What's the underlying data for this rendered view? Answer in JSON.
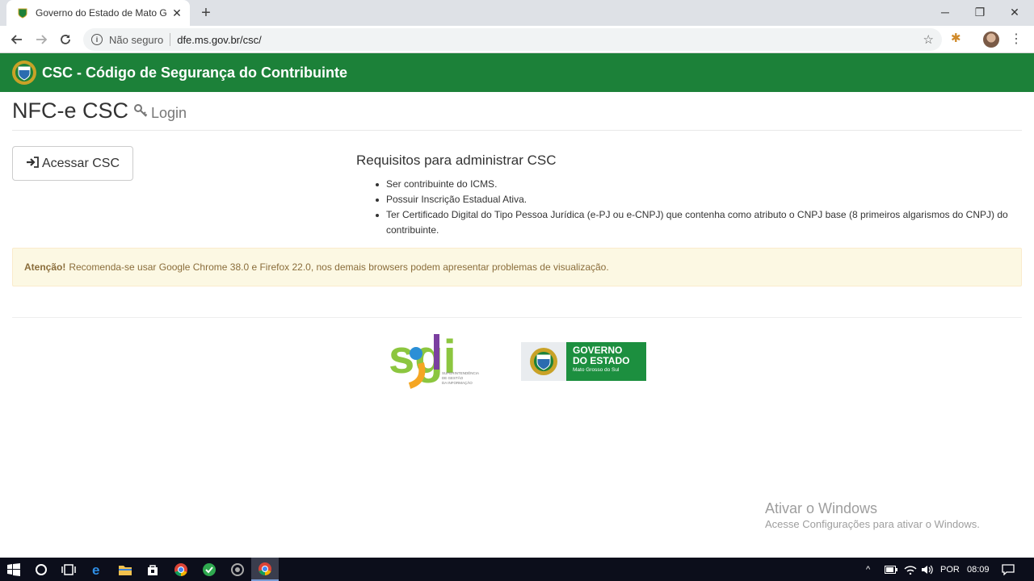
{
  "browser": {
    "tab_title": "Governo do Estado de Mato Gros",
    "security_label": "Não seguro",
    "url": "dfe.ms.gov.br/csc/"
  },
  "header": {
    "title": "CSC - Código de Segurança do Contribuinte",
    "color": "#1c8139"
  },
  "page": {
    "heading": "NFC-e CSC",
    "login": "Login",
    "access_button": "Acessar CSC",
    "requirements_title": "Requisitos para administrar CSC",
    "requirements": [
      "Ser contribuinte do ICMS.",
      "Possuir Inscrição Estadual Ativa.",
      "Ter Certificado Digital do Tipo Pessoa Jurídica (e-PJ ou e-CNPJ) que contenha como atributo o CNPJ base (8 primeiros algarismos do CNPJ) do contribuinte."
    ],
    "alert_strong": "Atenção!",
    "alert_text": "Recomenda-se usar Google Chrome 38.0 e Firefox 22.0, nos demais browsers podem apresentar problemas de visualização."
  },
  "logos": {
    "sgi_text": "sgi",
    "sgi_caption": [
      "SUPERINTENDÊNCIA",
      "DE GESTÃO",
      "DA INFORMAÇÃO"
    ],
    "gov_line1": "GOVERNO",
    "gov_line2": "DO ESTADO",
    "gov_line3": "Mato Grosso do Sul"
  },
  "watermark": {
    "line1": "Ativar o Windows",
    "line2": "Acesse Configurações para ativar o Windows."
  },
  "taskbar": {
    "language": "POR",
    "time": "08:09"
  }
}
